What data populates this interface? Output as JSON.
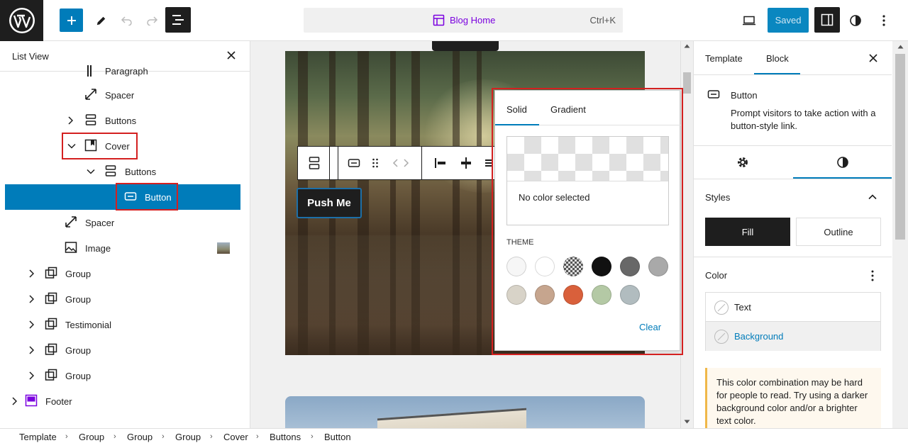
{
  "topbar": {
    "command_title": "Blog Home",
    "command_shortcut": "Ctrl+K",
    "saved_label": "Saved"
  },
  "list_view": {
    "title": "List View",
    "partial_item": "Paragraph",
    "items": [
      {
        "label": "Spacer",
        "icon": "resize-icon"
      },
      {
        "label": "Buttons",
        "icon": "buttons-icon"
      },
      {
        "label": "Cover",
        "icon": "cover-icon"
      },
      {
        "label": "Buttons",
        "icon": "buttons-icon"
      },
      {
        "label": "Button",
        "icon": "button-icon"
      },
      {
        "label": "Spacer",
        "icon": "resize-icon"
      },
      {
        "label": "Image",
        "icon": "image-icon"
      },
      {
        "label": "Group",
        "icon": "group-icon"
      },
      {
        "label": "Group",
        "icon": "group-icon"
      },
      {
        "label": "Testimonial",
        "icon": "group-icon"
      },
      {
        "label": "Group",
        "icon": "group-icon"
      },
      {
        "label": "Group",
        "icon": "group-icon"
      },
      {
        "label": "Footer",
        "icon": "template-part-icon"
      }
    ]
  },
  "canvas": {
    "button_text": "Push Me"
  },
  "color_popover": {
    "tabs": [
      "Solid",
      "Gradient"
    ],
    "no_color": "No color selected",
    "theme_label": "THEME",
    "swatches": [
      "#f6f6f6",
      "#ffffff",
      "checker",
      "#111111",
      "#686868",
      "#a9a9a9",
      "#d8d3c8",
      "#c6a58e",
      "#d9603b",
      "#b4c9a5",
      "#b1bcbf"
    ],
    "clear_label": "Clear"
  },
  "sidebar": {
    "tabs": [
      "Template",
      "Block"
    ],
    "block_title": "Button",
    "block_description": "Prompt visitors to take action with a button-style link.",
    "styles_title": "Styles",
    "fill_label": "Fill",
    "outline_label": "Outline",
    "color_title": "Color",
    "text_label": "Text",
    "background_label": "Background",
    "warning": "This color combination may be hard for people to read. Try using a darker background color and/or a brighter text color."
  },
  "breadcrumb": [
    "Template",
    "Group",
    "Group",
    "Group",
    "Cover",
    "Buttons",
    "Button"
  ],
  "colors": {
    "accent": "#007cba",
    "highlight": "#d42020",
    "site_editor_purple": "#7a00df"
  }
}
